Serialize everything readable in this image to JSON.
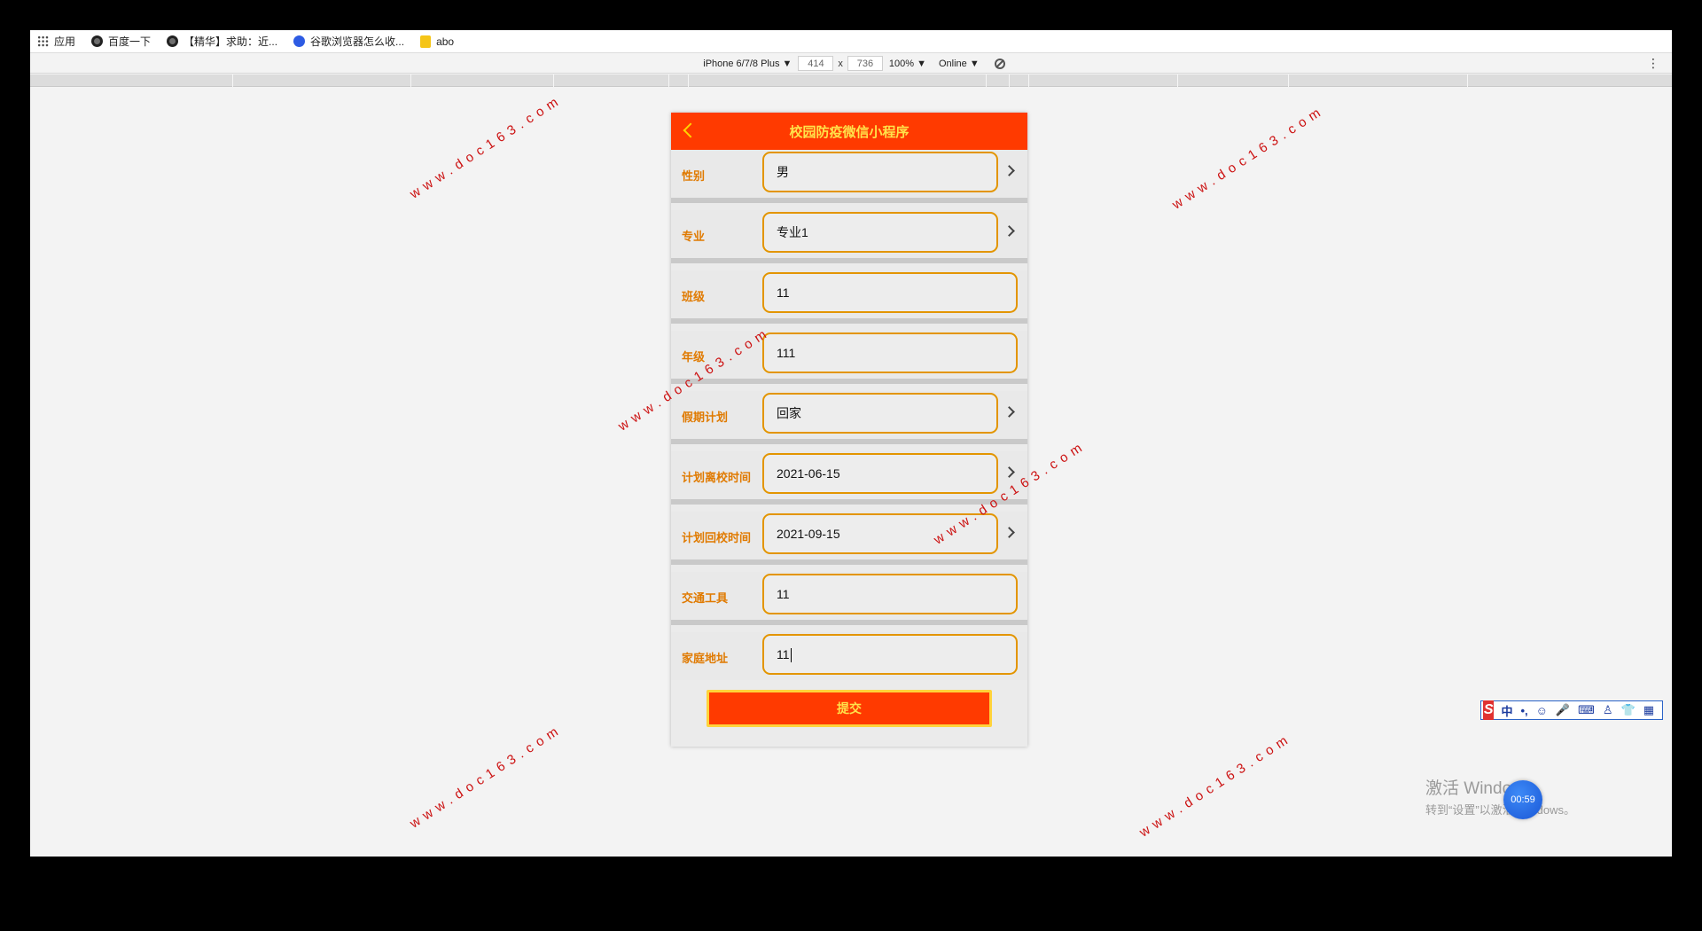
{
  "bookmarks": [
    {
      "label": "应用",
      "icon": "apps-icon"
    },
    {
      "label": "百度一下",
      "icon": "globe-icon"
    },
    {
      "label": "【精华】求助：近...",
      "icon": "globe-icon"
    },
    {
      "label": "谷歌浏览器怎么收...",
      "icon": "paw-icon"
    },
    {
      "label": "abo",
      "icon": "folder-icon"
    }
  ],
  "device_toolbar": {
    "device": "iPhone 6/7/8 Plus ▼",
    "width": "414",
    "times": "x",
    "height": "736",
    "zoom": "100% ▼",
    "network": "Online ▼"
  },
  "app": {
    "title": "校园防疫微信小程序",
    "fields": [
      {
        "label": "性别",
        "value": "男"
      },
      {
        "label": "专业",
        "value": "专业1"
      },
      {
        "label": "班级",
        "value": "11"
      },
      {
        "label": "年级",
        "value": "111"
      },
      {
        "label": "假期计划",
        "value": "回家"
      },
      {
        "label": "计划离校时间",
        "value": "2021-06-15"
      },
      {
        "label": "计划回校时间",
        "value": "2021-09-15"
      },
      {
        "label": "交通工具",
        "value": "11"
      },
      {
        "label": "家庭地址",
        "value": "11"
      }
    ],
    "submit_label": "提交"
  },
  "watermark_text": "www.doc163.com",
  "ime": {
    "logo": "S",
    "mode": "中"
  },
  "windows_activation": {
    "line1": "激活 Windows",
    "line2": "转到“设置”以激活 Windows。"
  },
  "recorder_timer": "00:59"
}
